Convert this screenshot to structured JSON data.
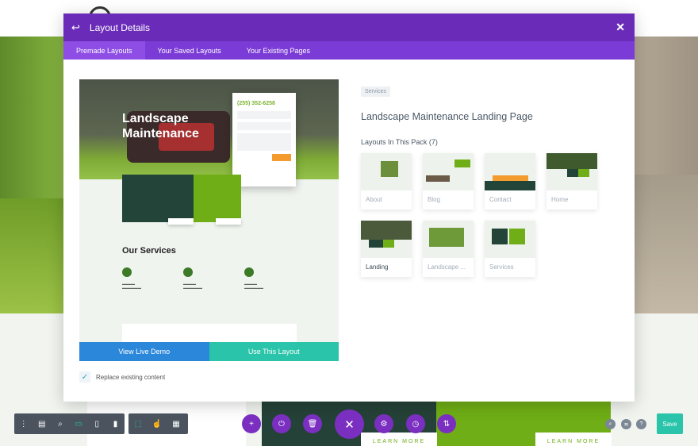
{
  "modal": {
    "title": "Layout Details",
    "tabs": [
      "Premade Layouts",
      "Your Saved Layouts",
      "Your Existing Pages"
    ]
  },
  "preview": {
    "hero_title": "Landscape Maintenance",
    "phone": "(255) 352-6258",
    "section_title": "Our Services",
    "buttons": {
      "demo": "View Live Demo",
      "use": "Use This Layout"
    }
  },
  "replace": {
    "label": "Replace existing content",
    "checked": true
  },
  "details": {
    "category": "Services",
    "title": "Landscape Maintenance Landing Page",
    "pack_heading": "Layouts In This Pack (7)",
    "layouts": [
      "About",
      "Blog",
      "Contact",
      "Home",
      "Landing",
      "Landscape ...",
      "Services"
    ]
  },
  "page": {
    "learn_more": "LEARN MORE",
    "save": "Save"
  },
  "colors": {
    "header": "#6a2cb8",
    "tabs": "#7b3bd6",
    "demo": "#2b87da",
    "use": "#29c4a9",
    "dark_green": "#254238",
    "green": "#6fae16"
  }
}
